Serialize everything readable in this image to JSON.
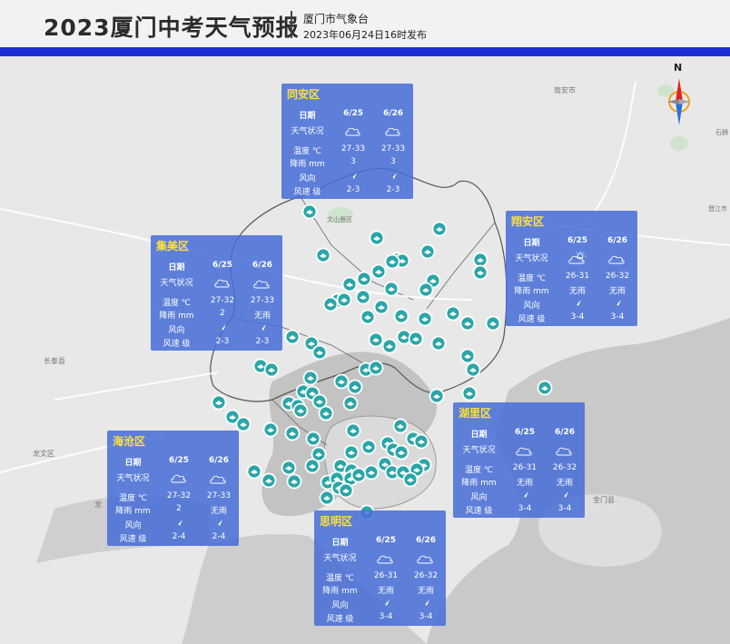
{
  "header": {
    "title": "2023厦门中考天气预报",
    "org": "厦门市气象台",
    "published": "2023年06月24日16时发布"
  },
  "compass": {
    "north_label": "N"
  },
  "map_labels": {
    "nanan": "南安市",
    "wenshan": "文山景区",
    "changtai": "长泰县",
    "longwen": "龙文区",
    "long": "龙",
    "jinmen": "金门县",
    "jinjiang": "晋江市",
    "shishi": "石狮"
  },
  "row_labels": {
    "date": "日期",
    "weather": "天气状况",
    "temp": "温度 ℃",
    "rain": "降雨 mm",
    "wind_dir": "风向",
    "wind_speed": "风速 级"
  },
  "districts": [
    {
      "key": "tongan",
      "name": "同安区",
      "days": [
        {
          "date": "6/25",
          "weather_icon": "cloudy-icon",
          "temp": "27-33",
          "rain": "3",
          "wind_speed": "2-3"
        },
        {
          "date": "6/26",
          "weather_icon": "cloudy-icon",
          "temp": "27-33",
          "rain": "3",
          "wind_speed": "2-3"
        }
      ]
    },
    {
      "key": "xiangan",
      "name": "翔安区",
      "days": [
        {
          "date": "6/25",
          "weather_icon": "partly-cloudy-icon",
          "temp": "26-31",
          "rain": "无雨",
          "wind_speed": "3-4"
        },
        {
          "date": "6/26",
          "weather_icon": "overcast-icon",
          "temp": "26-32",
          "rain": "无雨",
          "wind_speed": "3-4"
        }
      ]
    },
    {
      "key": "jimei",
      "name": "集美区",
      "days": [
        {
          "date": "6/25",
          "weather_icon": "cloudy-icon",
          "temp": "27-32",
          "rain": "2",
          "wind_speed": "2-3"
        },
        {
          "date": "6/26",
          "weather_icon": "overcast-icon",
          "temp": "27-33",
          "rain": "无雨",
          "wind_speed": "2-3"
        }
      ]
    },
    {
      "key": "huli",
      "name": "湖里区",
      "days": [
        {
          "date": "6/25",
          "weather_icon": "overcast-icon",
          "temp": "26-31",
          "rain": "无雨",
          "wind_speed": "3-4"
        },
        {
          "date": "6/26",
          "weather_icon": "overcast-icon",
          "temp": "26-32",
          "rain": "无雨",
          "wind_speed": "3-4"
        }
      ]
    },
    {
      "key": "haicang",
      "name": "海沧区",
      "days": [
        {
          "date": "6/25",
          "weather_icon": "cloudy-icon",
          "temp": "27-32",
          "rain": "2",
          "wind_speed": "2-4"
        },
        {
          "date": "6/26",
          "weather_icon": "overcast-icon",
          "temp": "27-33",
          "rain": "无雨",
          "wind_speed": "2-4"
        }
      ]
    },
    {
      "key": "siming",
      "name": "思明区",
      "days": [
        {
          "date": "6/25",
          "weather_icon": "overcast-icon",
          "temp": "26-31",
          "rain": "无雨",
          "wind_speed": "3-4"
        },
        {
          "date": "6/26",
          "weather_icon": "overcast-icon",
          "temp": "26-32",
          "rain": "无雨",
          "wind_speed": "3-4"
        }
      ]
    }
  ],
  "colors": {
    "accent_bar": "#1c2fd6",
    "panel": "#466ed7",
    "district_title": "#ffe03a",
    "exam_marker": "#2aa6a8"
  }
}
